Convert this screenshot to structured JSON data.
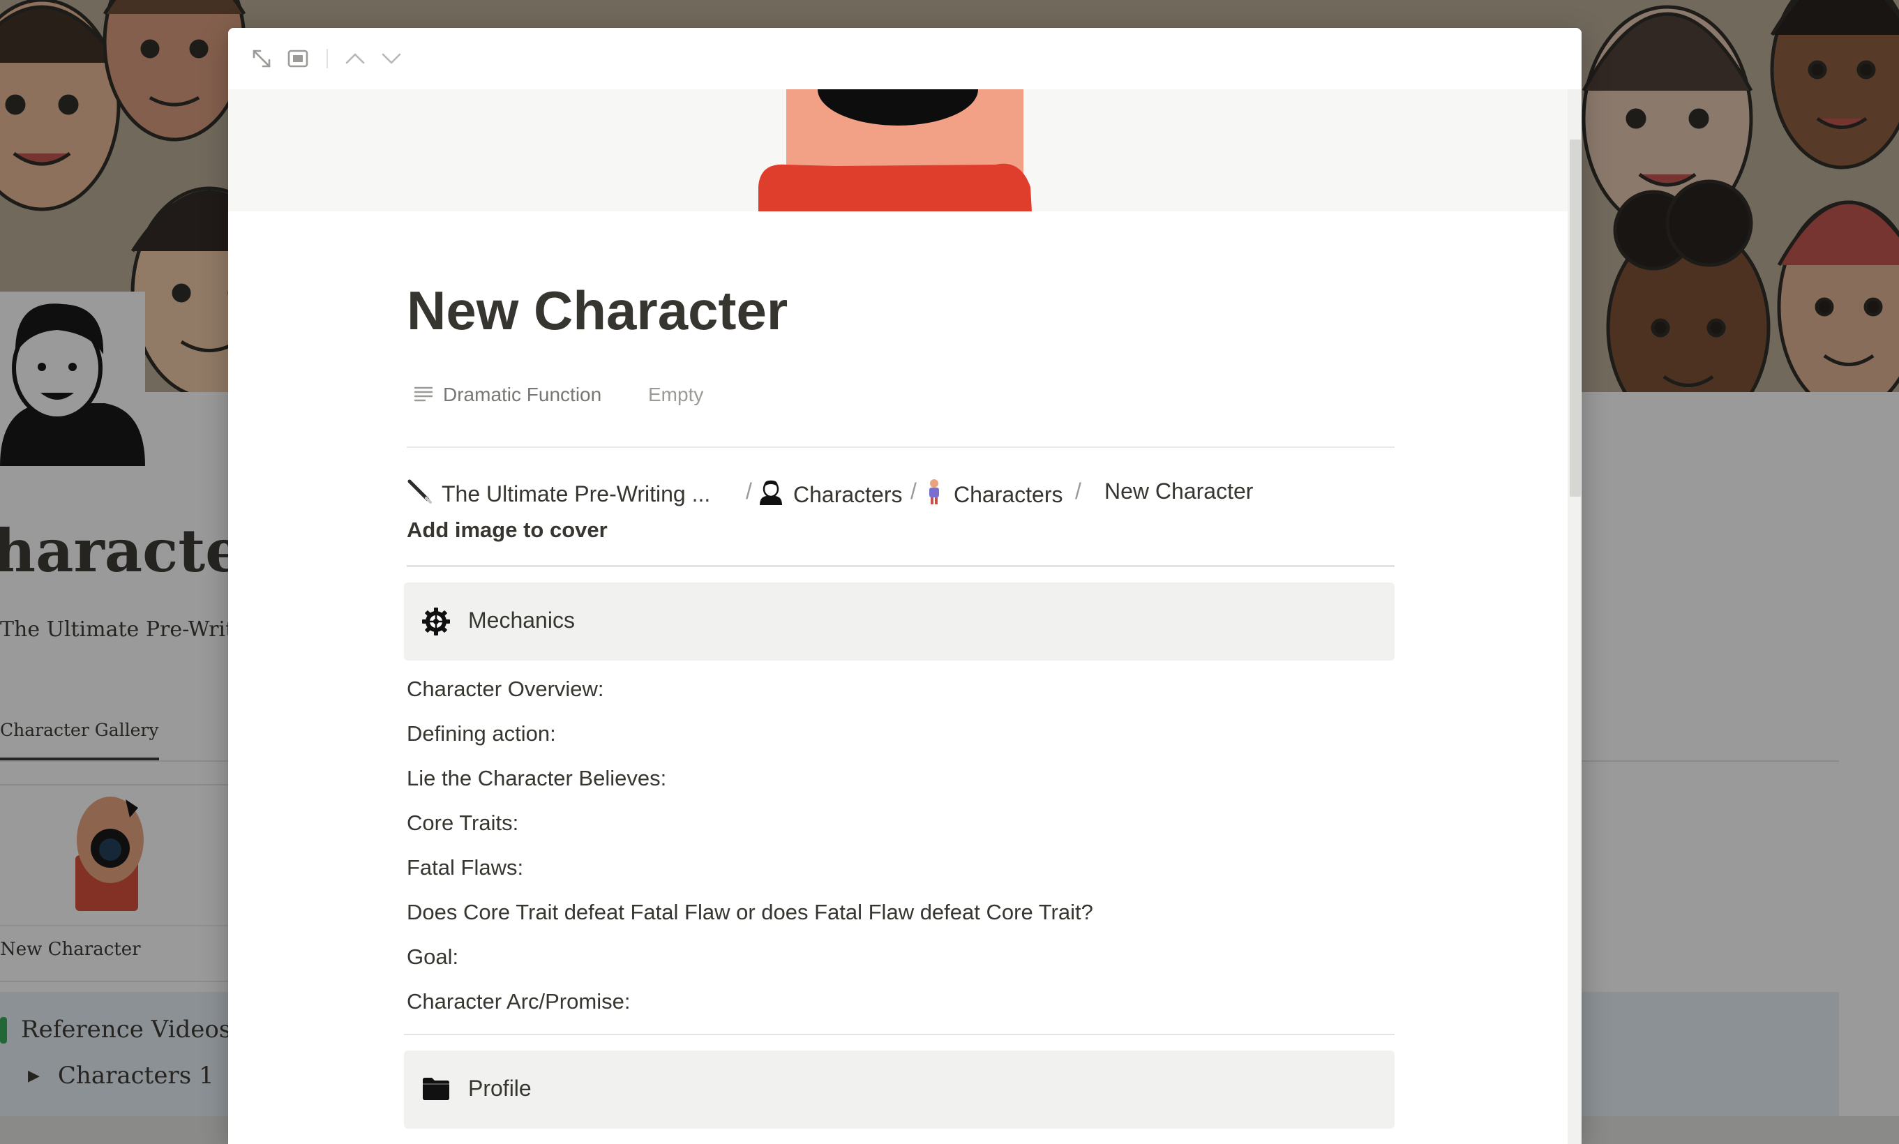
{
  "background_page": {
    "title": "haracters",
    "subtitle": "The Ultimate Pre-Writi",
    "tab": "Character Gallery",
    "card_label": "New Character",
    "callout_title": "Reference Videos",
    "toggle_item": "Characters 1"
  },
  "toolbar": {
    "expand_icon": "expand-diagonal-icon",
    "layout_icon": "side-peek-icon",
    "up_icon": "chevron-up-icon",
    "down_icon": "chevron-down-icon"
  },
  "page": {
    "title": "New Character",
    "property": {
      "label": "Dramatic Function",
      "value": "Empty",
      "icon": "text-lines-icon"
    },
    "breadcrumb": [
      {
        "label": "The Ultimate Pre-Writing ...",
        "icon": "pen-icon"
      },
      {
        "label": "Characters",
        "icon": "person-icon"
      },
      {
        "label": "Characters",
        "icon": "figure-icon"
      },
      {
        "label": "New Character",
        "icon": ""
      }
    ],
    "breadcrumb_separator": "/",
    "add_image": "Add image to cover",
    "sections": {
      "mechanics": {
        "label": "Mechanics",
        "icon": "gear-wheel-icon"
      },
      "profile": {
        "label": "Profile",
        "icon": "folder-icon"
      }
    },
    "fields": [
      "Character Overview:",
      "Defining action:",
      "Lie the Character Believes:",
      "Core Traits:",
      "Fatal Flaws:",
      "Does Core Trait defeat Fatal Flaw or does Fatal Flaw defeat Core Trait?",
      "Goal:",
      "Character Arc/Promise:"
    ]
  },
  "colors": {
    "text": "#37352f",
    "muted": "#787774",
    "block_bg": "#f1f1ef",
    "cover_shirt": "#e03e2d",
    "cover_skin": "#f4a48a",
    "callout_bg": "#e7f0f6"
  }
}
